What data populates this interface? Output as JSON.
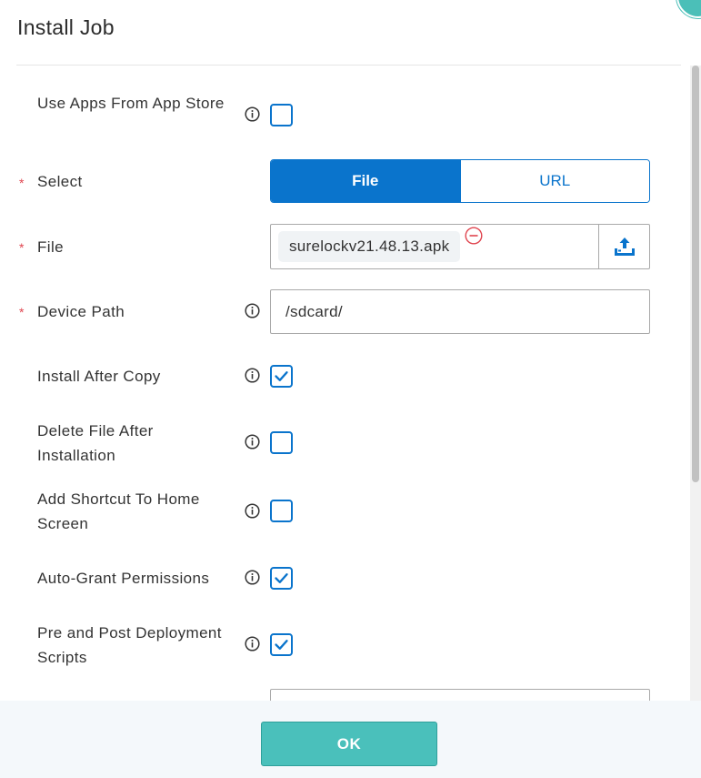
{
  "dialog": {
    "title": "Install Job",
    "ok_label": "OK"
  },
  "form": {
    "use_app_store": {
      "label": "Use Apps From App Store",
      "checked": false
    },
    "select": {
      "label": "Select",
      "required_mark": "*",
      "options": [
        "File",
        "URL"
      ],
      "selected": "File"
    },
    "file": {
      "label": "File",
      "required_mark": "*",
      "filename": "surelockv21.48.13.apk"
    },
    "device_path": {
      "label": "Device Path",
      "required_mark": "*",
      "value": "/sdcard/"
    },
    "install_after_copy": {
      "label": "Install After Copy",
      "checked": true
    },
    "delete_after_install": {
      "label": "Delete File After Installation",
      "checked": false
    },
    "add_shortcut": {
      "label": "Add Shortcut To Home Screen",
      "checked": false
    },
    "auto_grant": {
      "label": "Auto-Grant Permissions",
      "checked": true
    },
    "deploy_scripts": {
      "label": "Pre and Post Deployment Scripts",
      "checked": true
    }
  },
  "icons": {
    "info": "info-icon",
    "remove": "minus-circle-icon",
    "upload": "upload-icon",
    "check": "checkmark-icon"
  },
  "colors": {
    "primary": "#0a74cc",
    "ok_button": "#4ac0bb",
    "required": "#e0454f",
    "remove": "#e0454f",
    "footer_bg": "#f4f8fb"
  }
}
